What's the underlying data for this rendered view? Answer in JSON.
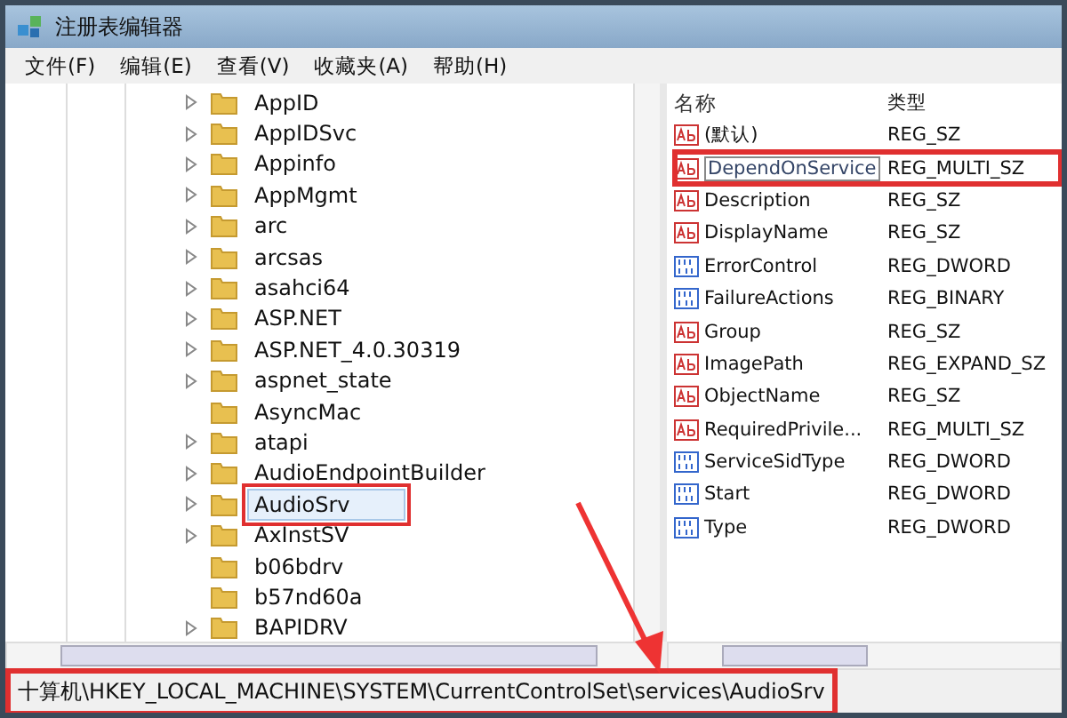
{
  "window": {
    "title": "注册表编辑器"
  },
  "menu": [
    "文件(F)",
    "编辑(E)",
    "查看(V)",
    "收藏夹(A)",
    "帮助(H)"
  ],
  "tree": [
    {
      "label": "AppID",
      "expandable": true,
      "selected": false,
      "highlighted": false
    },
    {
      "label": "AppIDSvc",
      "expandable": true,
      "selected": false,
      "highlighted": false
    },
    {
      "label": "Appinfo",
      "expandable": true,
      "selected": false,
      "highlighted": false
    },
    {
      "label": "AppMgmt",
      "expandable": true,
      "selected": false,
      "highlighted": false
    },
    {
      "label": "arc",
      "expandable": true,
      "selected": false,
      "highlighted": false
    },
    {
      "label": "arcsas",
      "expandable": true,
      "selected": false,
      "highlighted": false
    },
    {
      "label": "asahci64",
      "expandable": true,
      "selected": false,
      "highlighted": false
    },
    {
      "label": "ASP.NET",
      "expandable": true,
      "selected": false,
      "highlighted": false
    },
    {
      "label": "ASP.NET_4.0.30319",
      "expandable": true,
      "selected": false,
      "highlighted": false
    },
    {
      "label": "aspnet_state",
      "expandable": true,
      "selected": false,
      "highlighted": false
    },
    {
      "label": "AsyncMac",
      "expandable": false,
      "selected": false,
      "highlighted": false
    },
    {
      "label": "atapi",
      "expandable": true,
      "selected": false,
      "highlighted": false
    },
    {
      "label": "AudioEndpointBuilder",
      "expandable": true,
      "selected": false,
      "highlighted": false
    },
    {
      "label": "AudioSrv",
      "expandable": true,
      "selected": true,
      "highlighted": true
    },
    {
      "label": "AxInstSV",
      "expandable": true,
      "selected": false,
      "highlighted": false
    },
    {
      "label": "b06bdrv",
      "expandable": false,
      "selected": false,
      "highlighted": false
    },
    {
      "label": "b57nd60a",
      "expandable": false,
      "selected": false,
      "highlighted": false
    },
    {
      "label": "BAPIDRV",
      "expandable": true,
      "selected": false,
      "highlighted": false
    }
  ],
  "values": {
    "columns": [
      "名称",
      "类型"
    ],
    "rows": [
      {
        "kind": "string",
        "name": "(默认)",
        "type": "REG_SZ",
        "editing": false,
        "highlighted": false
      },
      {
        "kind": "string",
        "name": "DependOnService",
        "type": "REG_MULTI_SZ",
        "editing": true,
        "highlighted": true
      },
      {
        "kind": "string",
        "name": "Description",
        "type": "REG_SZ",
        "editing": false,
        "highlighted": false
      },
      {
        "kind": "string",
        "name": "DisplayName",
        "type": "REG_SZ",
        "editing": false,
        "highlighted": false
      },
      {
        "kind": "binary",
        "name": "ErrorControl",
        "type": "REG_DWORD",
        "editing": false,
        "highlighted": false
      },
      {
        "kind": "binary",
        "name": "FailureActions",
        "type": "REG_BINARY",
        "editing": false,
        "highlighted": false
      },
      {
        "kind": "string",
        "name": "Group",
        "type": "REG_SZ",
        "editing": false,
        "highlighted": false
      },
      {
        "kind": "string",
        "name": "ImagePath",
        "type": "REG_EXPAND_SZ",
        "editing": false,
        "highlighted": false
      },
      {
        "kind": "string",
        "name": "ObjectName",
        "type": "REG_SZ",
        "editing": false,
        "highlighted": false
      },
      {
        "kind": "string",
        "name": "RequiredPrivile...",
        "type": "REG_MULTI_SZ",
        "editing": false,
        "highlighted": false
      },
      {
        "kind": "binary",
        "name": "ServiceSidType",
        "type": "REG_DWORD",
        "editing": false,
        "highlighted": false
      },
      {
        "kind": "binary",
        "name": "Start",
        "type": "REG_DWORD",
        "editing": false,
        "highlighted": false
      },
      {
        "kind": "binary",
        "name": "Type",
        "type": "REG_DWORD",
        "editing": false,
        "highlighted": false
      }
    ]
  },
  "status_bar": {
    "path": "十算机\\HKEY_LOCAL_MACHINE\\SYSTEM\\CurrentControlSet\\services\\AudioSrv",
    "highlighted": true
  }
}
